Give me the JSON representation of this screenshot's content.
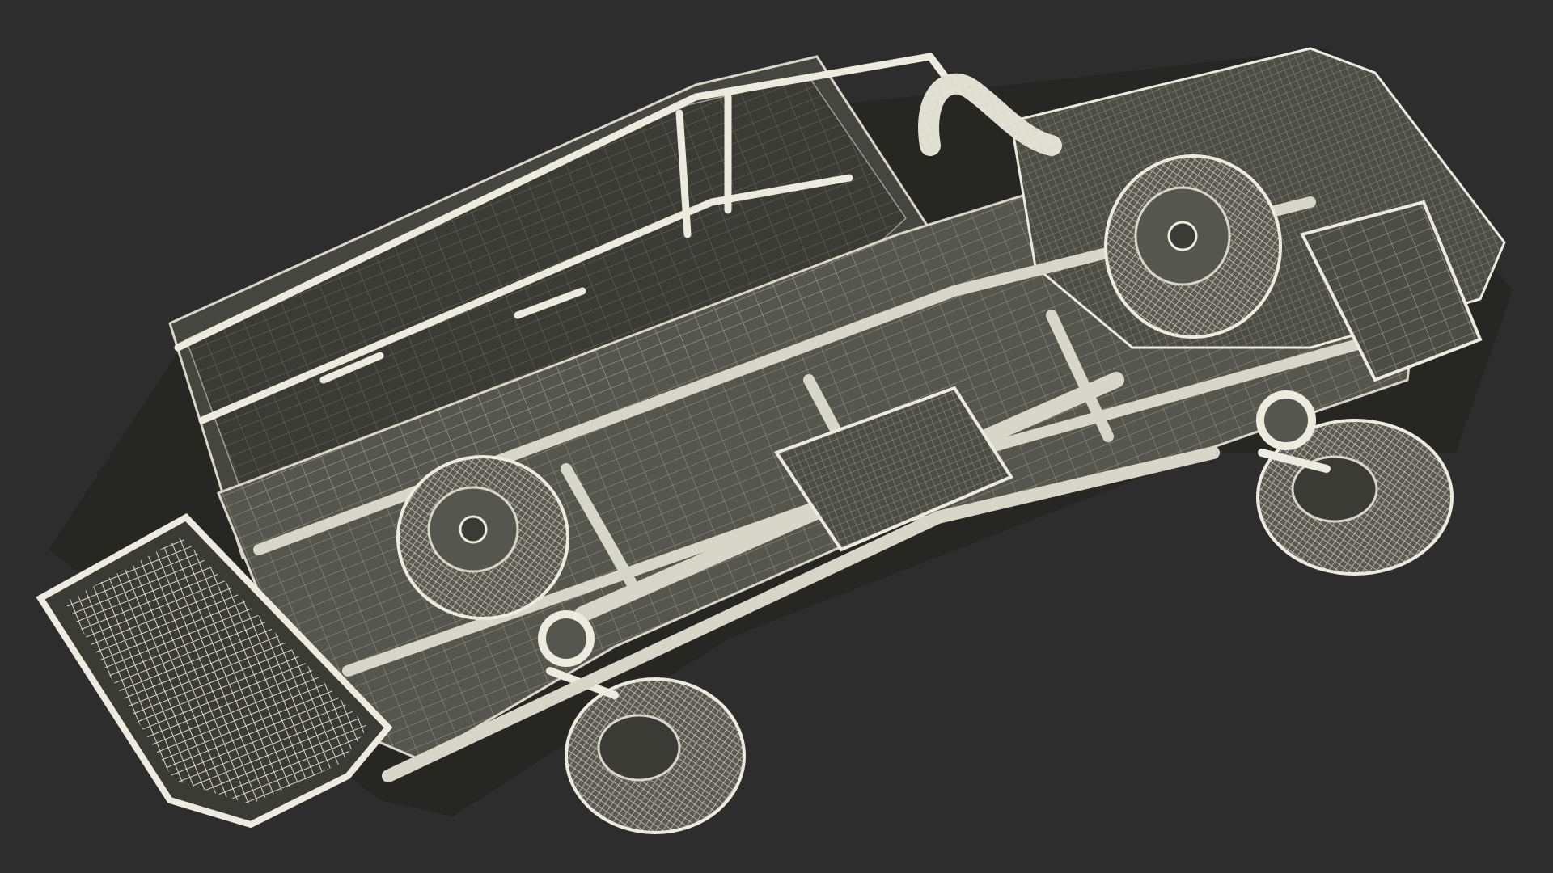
{
  "scene": {
    "subject": "wireframe-vehicle-underside",
    "colors": {
      "background": "#2d2d2d",
      "body_fill": "#45463f",
      "body_fill_dark": "#3a3b35",
      "panel_fill": "#55564e",
      "wire": "#d8d6c8",
      "wire_bright": "#ecebe0",
      "wire_dim": "#9e9c90",
      "shadow": "#262622"
    }
  }
}
